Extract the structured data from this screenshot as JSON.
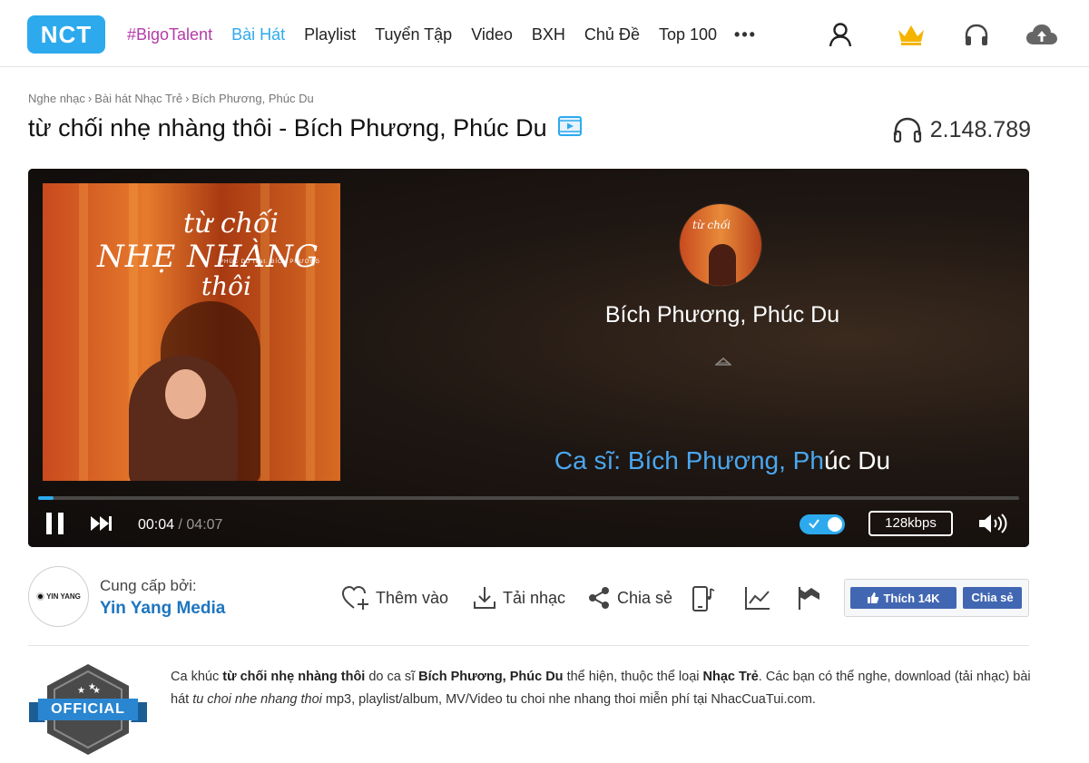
{
  "header": {
    "logo": "NCT",
    "nav": [
      "#BigoTalent",
      "Bài Hát",
      "Playlist",
      "Tuyển Tập",
      "Video",
      "BXH",
      "Chủ Đề",
      "Top 100"
    ],
    "more": "•••",
    "icons": [
      "user-icon",
      "crown-icon",
      "headphones-icon",
      "cloud-upload-icon"
    ],
    "colors": {
      "brand": "#2daaed",
      "bigo": "#b33ba9"
    }
  },
  "breadcrumb": [
    "Nghe nhạc",
    "Bài hát Nhạc Trẻ",
    "Bích Phương, Phúc Du"
  ],
  "song": {
    "title": "từ chối nhẹ nhàng thôi - Bích Phương, Phúc Du",
    "listens": "2.148.789"
  },
  "player": {
    "cover_text": {
      "line1": "từ chối",
      "line2": "NHẸ NHÀNG",
      "line3": "thôi",
      "small": "PHÚC DU  feat. BÍCH PHƯƠNG"
    },
    "avatar_text": "từ chối",
    "artist": "Bích Phương, Phúc Du",
    "lyric_sung": "Ca sĩ: Bích Phương, Ph",
    "lyric_rest": "úc Du",
    "current_time": "00:04",
    "duration": "/ 04:07",
    "progress_fraction": 0.016,
    "quality": "128kbps",
    "lyric_toggle_on": true
  },
  "provider": {
    "logo_text": "YIN YANG",
    "label": "Cung cấp bởi:",
    "name": "Yin Yang Media"
  },
  "actions": {
    "add": "Thêm vào",
    "download": "Tải nhạc",
    "share": "Chia sẻ"
  },
  "facebook": {
    "like": "Thích 14K",
    "share": "Chia sẻ"
  },
  "official_badge": "OFFICIAL",
  "description": {
    "p1": "Ca khúc ",
    "song": "từ chối nhẹ nhàng thôi",
    "p2": " do ca sĩ ",
    "artist": "Bích Phương, Phúc Du",
    "p3": " thể hiện, thuộc thể loại ",
    "genre": "Nhạc Trẻ",
    "p4": ". Các bạn có thể nghe, download (tải nhạc) bài hát ",
    "slug": "tu choi nhe nhang thoi",
    "p5": " mp3, playlist/album, MV/Video tu choi nhe nhang thoi miễn phí tại NhacCuaTui.com."
  }
}
